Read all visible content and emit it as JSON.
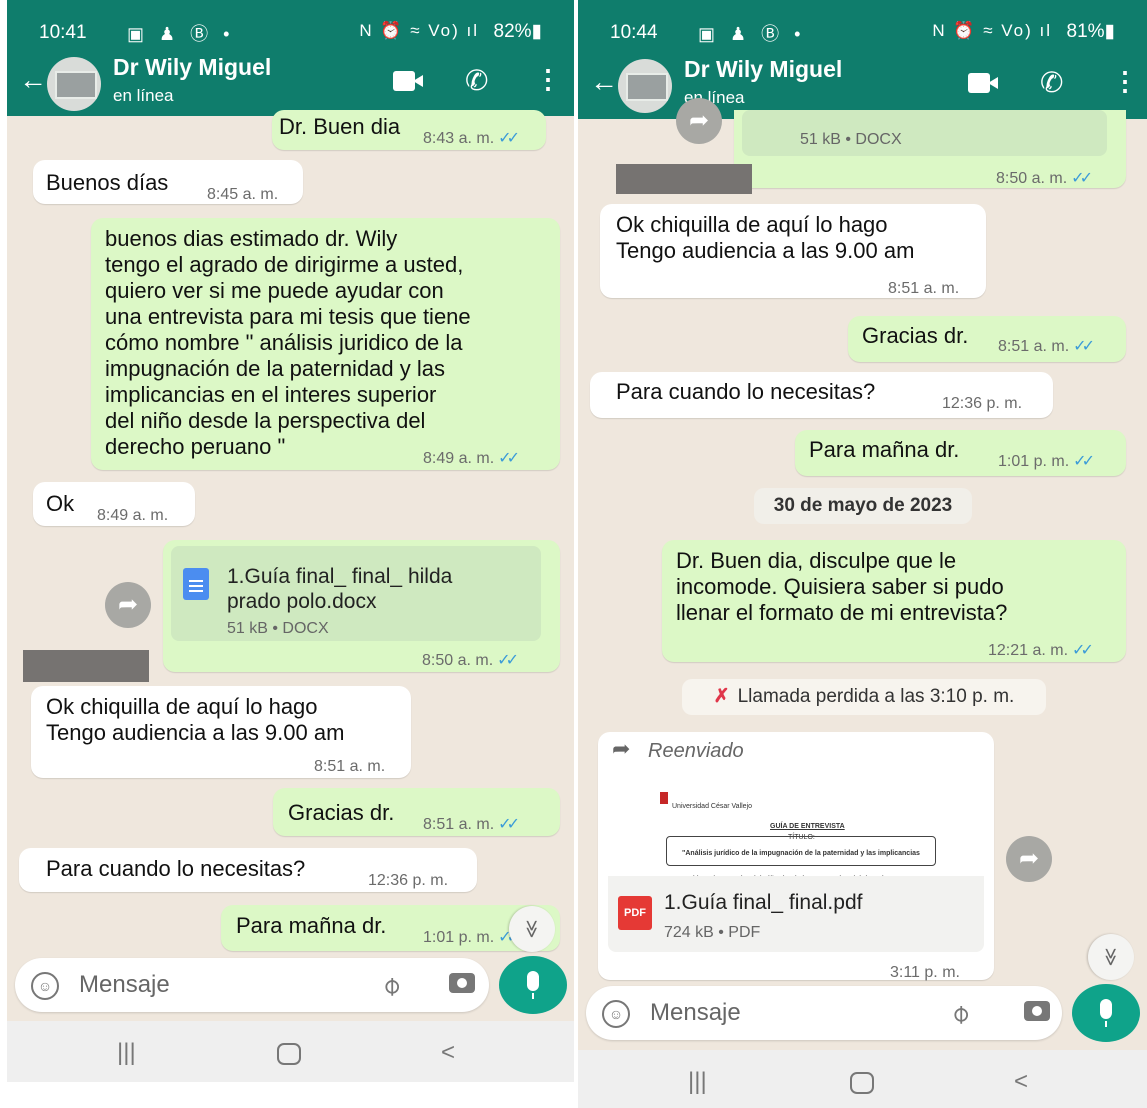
{
  "left": {
    "status": {
      "time": "10:41",
      "icons": "▣ ♟ Ⓑ •",
      "right_icons": "N ⏰ ≈ Vo) ıl",
      "battery": "82%▮"
    },
    "header": {
      "name": "Dr Wily Miguel",
      "status": "en línea"
    },
    "messages": [
      {
        "text": "Dr. Buen dia",
        "time": "8:43 a. m."
      },
      {
        "text": "Buenos días",
        "time": "8:45 a. m."
      },
      {
        "text": "buenos dias estimado dr. Wily\ntengo el agrado de dirigirme a usted,\nquiero  ver si me puede ayudar con\nuna entrevista para mi tesis que tiene\ncómo nombre \" análisis juridico de la\nimpugnación de la paternidad y las\nimplicancias en el interes superior\ndel niño  desde la perspectiva del\nderecho peruano \"",
        "time": "8:49 a. m."
      },
      {
        "text": "Ok",
        "time": "8:49 a. m."
      },
      {
        "doc_name": "1.Guía final_ final_ hilda\nprado polo.docx",
        "doc_meta": "51 kB • DOCX",
        "time": "8:50 a. m."
      },
      {
        "text": "Ok chiquilla de aquí lo hago\nTengo audiencia a las 9.00 am",
        "time": "8:51 a. m."
      },
      {
        "text": "Gracias dr.",
        "time": "8:51 a. m."
      },
      {
        "text": "Para cuando lo necesitas?",
        "time": "12:36 p. m."
      },
      {
        "text": "Para mañna dr.",
        "time": "1:01 p. m."
      }
    ],
    "input": {
      "placeholder": "Mensaje"
    }
  },
  "right": {
    "status": {
      "time": "10:44",
      "icons": "▣ ♟ Ⓑ •",
      "right_icons": "N ⏰ ≈ Vo) ıl",
      "battery": "81%▮"
    },
    "header": {
      "name": "Dr Wily Miguel",
      "status": "en línea"
    },
    "messages": [
      {
        "doc_meta": "51 kB • DOCX",
        "time": "8:50 a. m."
      },
      {
        "text": "Ok chiquilla de aquí lo hago\nTengo audiencia a las 9.00 am",
        "time": "8:51 a. m."
      },
      {
        "text": "Gracias dr.",
        "time": "8:51 a. m."
      },
      {
        "text": "Para cuando lo necesitas?",
        "time": "12:36 p. m."
      },
      {
        "text": "Para mañna dr.",
        "time": "1:01 p. m."
      },
      {
        "date": "30 de mayo de 2023"
      },
      {
        "text": "Dr. Buen dia, disculpe que le\nincomode. Quisiera saber si pudo\nllenar el formato de mi entrevista?",
        "time": "12:21 a. m."
      },
      {
        "call": "Llamada perdida a las 3:10 p. m."
      },
      {
        "forwarded": "Reenviado",
        "preview_org": "Universidad César Vallejo",
        "preview_title": "GUÍA DE ENTREVISTA",
        "preview_sub": "TÍTULO:",
        "preview_body": "\"Análisis jurídico de la impugnación de la paternidad y las implicancias\nen el interés superior del niño desde la perspectiva del derecho peruano\"",
        "preview_foot": "I.  Datos generales:",
        "pdf_badge": "PDF",
        "doc_name": "1.Guía final_ final.pdf",
        "doc_meta": "724 kB • PDF",
        "time": "3:11 p. m."
      }
    ],
    "input": {
      "placeholder": "Mensaje"
    }
  },
  "glyphs": {
    "back": "←",
    "phone": "✆",
    "menu": "⋮",
    "share": "➦",
    "scroll": "≫",
    "emoji": "☺",
    "attach": "⌀",
    "recent": "|||",
    "nav_back": "<",
    "ticks": "✓✓",
    "call_missed": "✗",
    "forward": "➦"
  }
}
